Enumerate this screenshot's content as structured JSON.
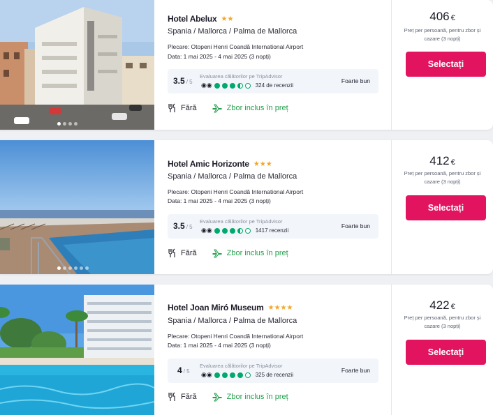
{
  "hotels": [
    {
      "name": "Hotel Abelux",
      "stars": "★★",
      "location": "Spania / Mallorca / Palma de Mallorca",
      "departure": "Plecare: Otopeni Henri Coandă International Airport",
      "dates": "Data: 1 mai 2025 - 4 mai 2025 (3 nopți)",
      "score": "3.5",
      "score_max": "/ 5",
      "ta_label": "Evaluarea călătorilor pe TripAdvisor",
      "bubbles": 3.5,
      "reviews": "324 de recenzii",
      "verdict": "Foarte bun",
      "meal": "Fără",
      "flight": "Zbor inclus în preț",
      "price": "406",
      "currency": "€",
      "price_note": "Preț per persoană, pentru zbor și cazare (3 nopți)",
      "button": "Selectați",
      "photo": "hotel-building"
    },
    {
      "name": "Hotel Amic Horizonte",
      "stars": "★★★",
      "location": "Spania / Mallorca / Palma de Mallorca",
      "departure": "Plecare: Otopeni Henri Coandă International Airport",
      "dates": "Data: 1 mai 2025 - 4 mai 2025 (3 nopți)",
      "score": "3.5",
      "score_max": "/ 5",
      "ta_label": "Evaluarea călătorilor pe TripAdvisor",
      "bubbles": 3.5,
      "reviews": "1417 recenzii",
      "verdict": "Foarte bun",
      "meal": "Fără",
      "flight": "Zbor inclus în preț",
      "price": "412",
      "currency": "€",
      "price_note": "Preț per persoană, pentru zbor și cazare (3 nopți)",
      "button": "Selectați",
      "photo": "sea-terrace-pool"
    },
    {
      "name": "Hotel Joan Miró Museum",
      "stars": "★★★★",
      "location": "Spania / Mallorca / Palma de Mallorca",
      "departure": "Plecare: Otopeni Henri Coandă International Airport",
      "dates": "Data: 1 mai 2025 - 4 mai 2025 (3 nopți)",
      "score": "4",
      "score_max": "/ 5",
      "ta_label": "Evaluarea călătorilor pe TripAdvisor",
      "bubbles": 4,
      "reviews": "325 de recenzii",
      "verdict": "Foarte bun",
      "meal": "Fără",
      "flight": "Zbor inclus în preț",
      "price": "422",
      "currency": "€",
      "price_note": "Preț per persoană, pentru zbor și cazare (3 nopți)",
      "button": "Selectați",
      "photo": "palm-pool-hotel"
    }
  ],
  "icons": {
    "meal": "cutlery-icon",
    "flight": "plane-icon",
    "tripadvisor": "owl-icon"
  },
  "colors": {
    "accent": "#e2135f",
    "flight_green": "#22a04b",
    "star": "#f5a623",
    "tripadvisor": "#00aa6c"
  }
}
